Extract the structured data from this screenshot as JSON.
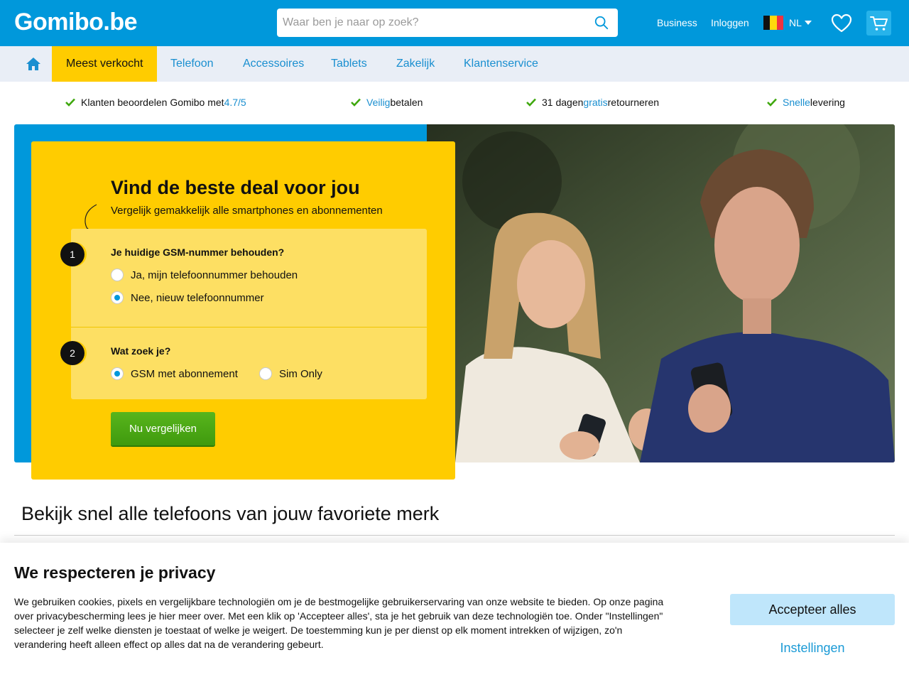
{
  "header": {
    "logo": "Gomibo.be",
    "search_placeholder": "Waar ben je naar op zoek?",
    "links": {
      "business": "Business",
      "login": "Inloggen"
    },
    "language": "NL",
    "icons": {
      "search": "search-icon",
      "favorites": "heart-icon",
      "cart": "cart-icon",
      "flag": "belgium-flag-icon"
    }
  },
  "nav": {
    "home_icon": "home-icon",
    "items": [
      {
        "label": "Meest verkocht",
        "active": true
      },
      {
        "label": "Telefoon"
      },
      {
        "label": "Accessoires"
      },
      {
        "label": "Tablets"
      },
      {
        "label": "Zakelijk"
      },
      {
        "label": "Klantenservice"
      }
    ]
  },
  "usps": [
    {
      "pre": "Klanten beoordelen Gomibo met ",
      "hl": "4.7/5",
      "post": ""
    },
    {
      "pre": "",
      "hl": "Veilig",
      "post": " betalen"
    },
    {
      "pre": "31 dagen ",
      "hl": "gratis",
      "post": " retourneren"
    },
    {
      "pre": "",
      "hl": "Snelle",
      "post": " levering"
    }
  ],
  "hero": {
    "title": "Vind de beste deal voor jou",
    "subtitle": "Vergelijk gemakkelijk alle smartphones en abonnementen",
    "q1": {
      "step": "1",
      "title": "Je huidige GSM-nummer behouden?",
      "options": [
        "Ja, mijn telefoonnummer behouden",
        "Nee, nieuw telefoonnummer"
      ],
      "selected": 1
    },
    "q2": {
      "step": "2",
      "title": "Wat zoek je?",
      "options": [
        "GSM met abonnement",
        "Sim Only"
      ],
      "selected": 0
    },
    "cta": "Nu vergelijken"
  },
  "brands": {
    "title": "Bekijk snel alle telefoons van jouw favoriete merk"
  },
  "cookie": {
    "title": "We respecteren je privacy",
    "text": "We gebruiken cookies, pixels en vergelijkbare technologiën om je de bestmogelijke gebruikerservaring van onze website te bieden. Op onze pagina over privacybescherming lees je hier meer over. Met een klik op 'Accepteer alles', sta je het gebruik van deze technologiën toe. Onder \"Instellingen\" selecteer je zelf welke diensten je toestaat of welke je weigert. De toestemming kun je per dienst op elk moment intrekken of wijzigen, zo'n verandering heeft alleen effect op alles dat na de verandering gebeurt.",
    "accept": "Accepteer alles",
    "settings": "Instellingen"
  },
  "colors": {
    "brand_blue": "#0098db",
    "brand_yellow": "#ffcc00",
    "cta_green": "#4aa814",
    "link_blue": "#1a8fd0"
  }
}
